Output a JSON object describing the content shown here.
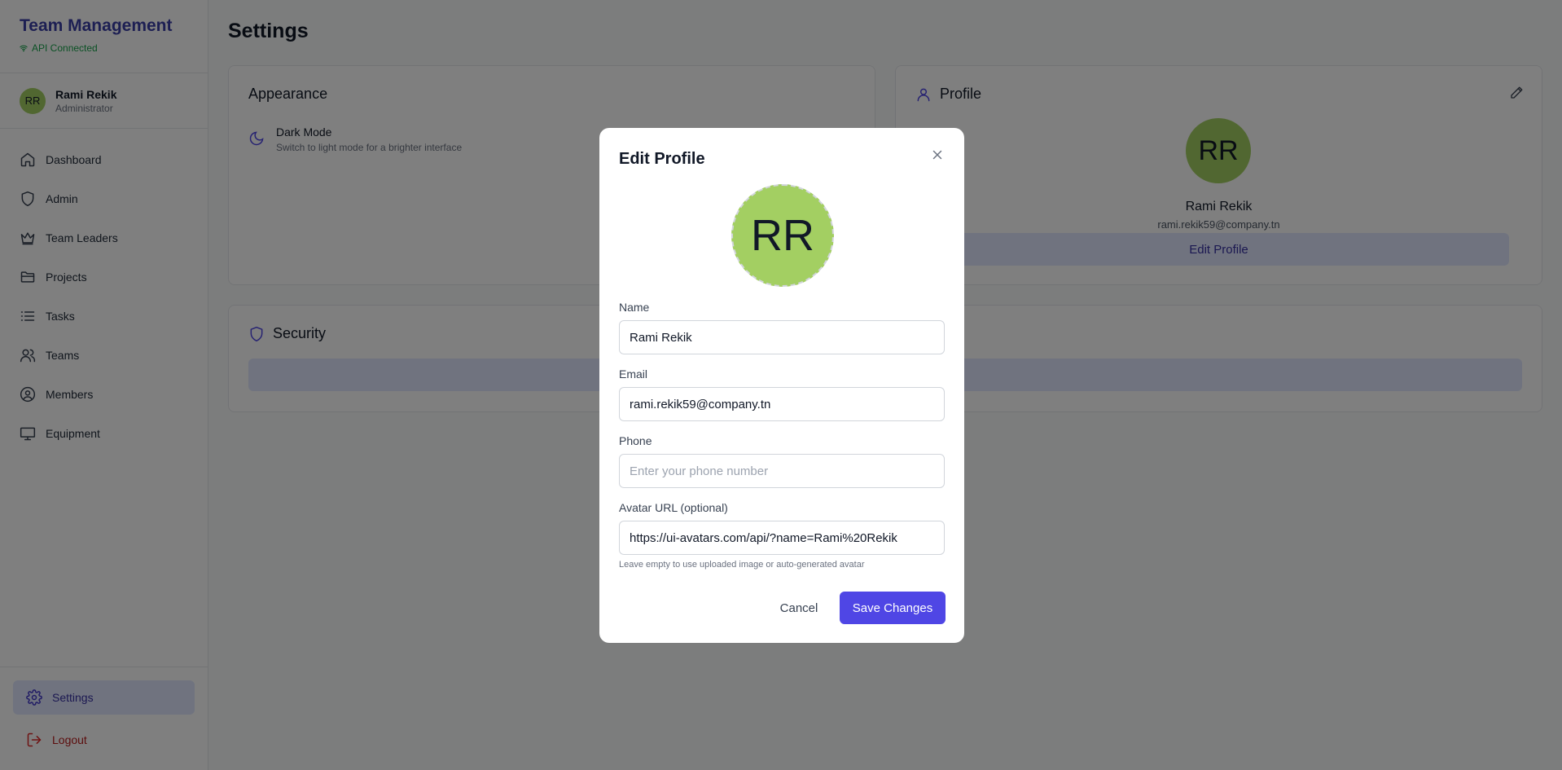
{
  "app": {
    "brand_title": "Team Management",
    "api_status": "API Connected",
    "colors": {
      "accent": "#4f46e5",
      "brand": "#3b3fa6",
      "success": "#16a34a",
      "danger": "#dc2626",
      "avatar_bg": "#a3cf62"
    }
  },
  "user": {
    "initials": "RR",
    "name": "Rami Rekik",
    "role": "Administrator"
  },
  "sidebar": {
    "items": [
      {
        "label": "Dashboard",
        "icon": "home-icon"
      },
      {
        "label": "Admin",
        "icon": "shield-icon"
      },
      {
        "label": "Team Leaders",
        "icon": "crown-icon"
      },
      {
        "label": "Projects",
        "icon": "folder-icon"
      },
      {
        "label": "Tasks",
        "icon": "list-icon"
      },
      {
        "label": "Teams",
        "icon": "users-icon"
      },
      {
        "label": "Members",
        "icon": "user-circle-icon"
      },
      {
        "label": "Equipment",
        "icon": "monitor-icon"
      }
    ],
    "settings_label": "Settings",
    "logout_label": "Logout"
  },
  "main": {
    "page_title": "Settings",
    "appearance": {
      "title": "Appearance",
      "dark_mode_title": "Dark Mode",
      "dark_mode_desc": "Switch to light mode for a brighter interface"
    },
    "profile": {
      "title": "Profile",
      "initials": "RR",
      "name": "Rami Rekik",
      "email": "rami.rekik59@company.tn",
      "edit_button": "Edit Profile"
    },
    "security": {
      "title": "Security"
    }
  },
  "modal": {
    "title": "Edit Profile",
    "avatar_initials": "RR",
    "name_label": "Name",
    "name_value": "Rami Rekik",
    "email_label": "Email",
    "email_value": "rami.rekik59@company.tn",
    "phone_label": "Phone",
    "phone_placeholder": "Enter your phone number",
    "phone_value": "",
    "avatar_url_label": "Avatar URL (optional)",
    "avatar_url_value": "https://ui-avatars.com/api/?name=Rami%20Rekik",
    "avatar_url_help": "Leave empty to use uploaded image or auto-generated avatar",
    "cancel_label": "Cancel",
    "save_label": "Save Changes"
  }
}
